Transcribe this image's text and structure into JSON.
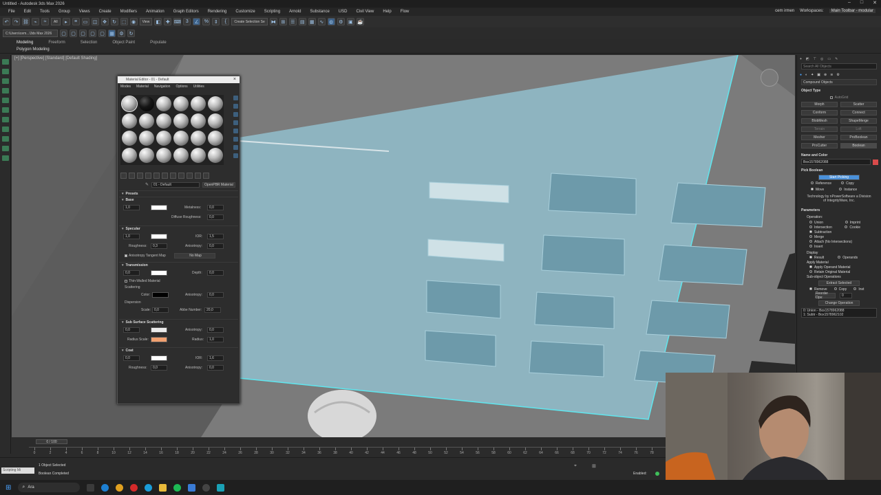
{
  "window": {
    "title": "Untitled - Autodesk 3ds Max 2026"
  },
  "menu": {
    "items": [
      "File",
      "Edit",
      "Tools",
      "Group",
      "Views",
      "Create",
      "Modifiers",
      "Animation",
      "Graph Editors",
      "Rendering",
      "Customize",
      "Scripting",
      "Arnold",
      "Substance",
      "USD",
      "Civil View",
      "Help",
      "Flow"
    ],
    "user": "cem irmen",
    "workspace_label": "Workspaces:",
    "workspace_value": "Main Toolbar - modular"
  },
  "toolbar": {
    "filter_value": "All",
    "view_value": "View",
    "create_selection_set": "Create Selection Se",
    "path_value": "C:\\Users\\cem...\\3ds Max 2026"
  },
  "ribbon": {
    "tabs": [
      "Modeling",
      "Freeform",
      "Selection",
      "Object Paint",
      "Populate"
    ],
    "sub_label": "Polygon Modeling"
  },
  "viewport": {
    "label": "[+] [Perspective] [Standard] [Default Shading]"
  },
  "material_editor": {
    "title": "Material Editor - 01 - Default",
    "menu": [
      "Modes",
      "Material",
      "Navigation",
      "Options",
      "Utilities"
    ],
    "material_name": "01 - Default",
    "material_type": "OpenPBR Material",
    "sections": {
      "presets": "Presets",
      "base": "Base",
      "specular": "Specular",
      "transmission": "Transmission",
      "sss": "Sub Surface Scattering",
      "coat": "Coat"
    },
    "base": {
      "weight": "1,0",
      "metalness_label": "Metalness:",
      "metalness": "0,0",
      "diffuse_roughness_label": "Diffuse Roughness:",
      "diffuse_roughness": "0,0"
    },
    "specular": {
      "weight": "1,0",
      "ior_label": "IOR:",
      "ior": "1,5",
      "roughness_label": "Roughness:",
      "roughness": "0,3",
      "anisotropy_label": "Anisotropy:",
      "anisotropy": "0,0",
      "tangent_map_label": "Anisotropy Tangent Map",
      "no_map": "No Map"
    },
    "transmission": {
      "weight": "0,0",
      "depth_label": "Depth:",
      "depth": "0,0",
      "thin_walled_label": "Thin-Walled Material",
      "scattering_label": "Scattering",
      "color_label": "Color:",
      "anisotropy_label": "Anisotropy:",
      "anisotropy": "0,0",
      "dispersion_label": "Dispersion",
      "scale_label": "Scale:",
      "scale": "0,0",
      "abbe_label": "Abbe Number:",
      "abbe": "20,0"
    },
    "sss": {
      "weight": "0,0",
      "anisotropy_label": "Anisotropy:",
      "anisotropy": "0,0",
      "radius_scale_label": "Radius Scale:",
      "radius_label": "Radius:",
      "radius": "1,0"
    },
    "coat": {
      "weight": "0,0",
      "ior_label": "IOR:",
      "ior": "1,6",
      "roughness_label": "Roughness:",
      "roughness": "0,0",
      "anisotropy_label": "Anisotropy:",
      "anisotropy": "0,0"
    }
  },
  "command_panel": {
    "search_placeholder": "Search All Objects",
    "category": "Compound Objects",
    "object_type_head": "Object Type",
    "autogrid": "AutoGrid",
    "buttons": [
      [
        "Morph",
        "Scatter"
      ],
      [
        "Conform",
        "Connect"
      ],
      [
        "BlobMesh",
        "ShapeMerge"
      ],
      [
        "Terrain",
        "Loft"
      ],
      [
        "Mesher",
        "ProBoolean"
      ],
      [
        "ProCutter",
        "Boolean"
      ]
    ],
    "name_color_head": "Name and Color",
    "object_name": "Box1578962088",
    "pick_boolean_head": "Pick Boolean",
    "start_picking": "Start Picking",
    "pick_opts": [
      "Reference",
      "Copy",
      "Move",
      "Instance"
    ],
    "tech_note": "Technology by nPowerSoftware a Division of IntegrityWare, Inc.",
    "parameters_head": "Parameters",
    "operation_label": "Operation:",
    "operations": [
      "Union",
      "Intersection",
      "Subtraction",
      "Merge",
      "Attach (No Intersections)",
      "Insert"
    ],
    "operations_right": [
      "Imprint",
      "Cookie"
    ],
    "display_label": "Display",
    "display_opts": [
      "Result",
      "Operands"
    ],
    "apply_material_label": "Apply Material",
    "apply_material_opts": [
      "Apply Operand Material",
      "Retain Original Material"
    ],
    "sub_object_label": "Sub-object Operations",
    "extract_selected": "Extract Selected",
    "extract_opts": [
      "Remove",
      "Copy",
      "Inst"
    ],
    "reorder_label": "Reorder Ops:",
    "reorder_value": "0",
    "change_operation": "Change Operation",
    "operands_list": [
      "0: Union - Box1578962088",
      "1: Subtr - Box1578962102"
    ]
  },
  "timeline": {
    "slider": "0 / 100",
    "ticks": [
      "0",
      "2",
      "4",
      "6",
      "8",
      "10",
      "12",
      "14",
      "16",
      "18",
      "20",
      "22",
      "24",
      "26",
      "28",
      "30",
      "32",
      "34",
      "36",
      "38",
      "40",
      "42",
      "44",
      "46",
      "48",
      "50",
      "52",
      "54",
      "56",
      "58",
      "60",
      "62",
      "64",
      "66",
      "68",
      "70",
      "72",
      "74",
      "76",
      "78"
    ]
  },
  "status": {
    "selected": "1 Object Selected",
    "message": "Boolean Completed",
    "script_label": "Scripting Mi",
    "enabled": "Enabled:"
  },
  "taskbar": {
    "search_label": "Ara"
  },
  "colors": {
    "accent": "#4a90d9",
    "viewport_bg": "#6b6b6b",
    "glass": "#8fb8c6",
    "radius_swatch": "#f0a070"
  }
}
